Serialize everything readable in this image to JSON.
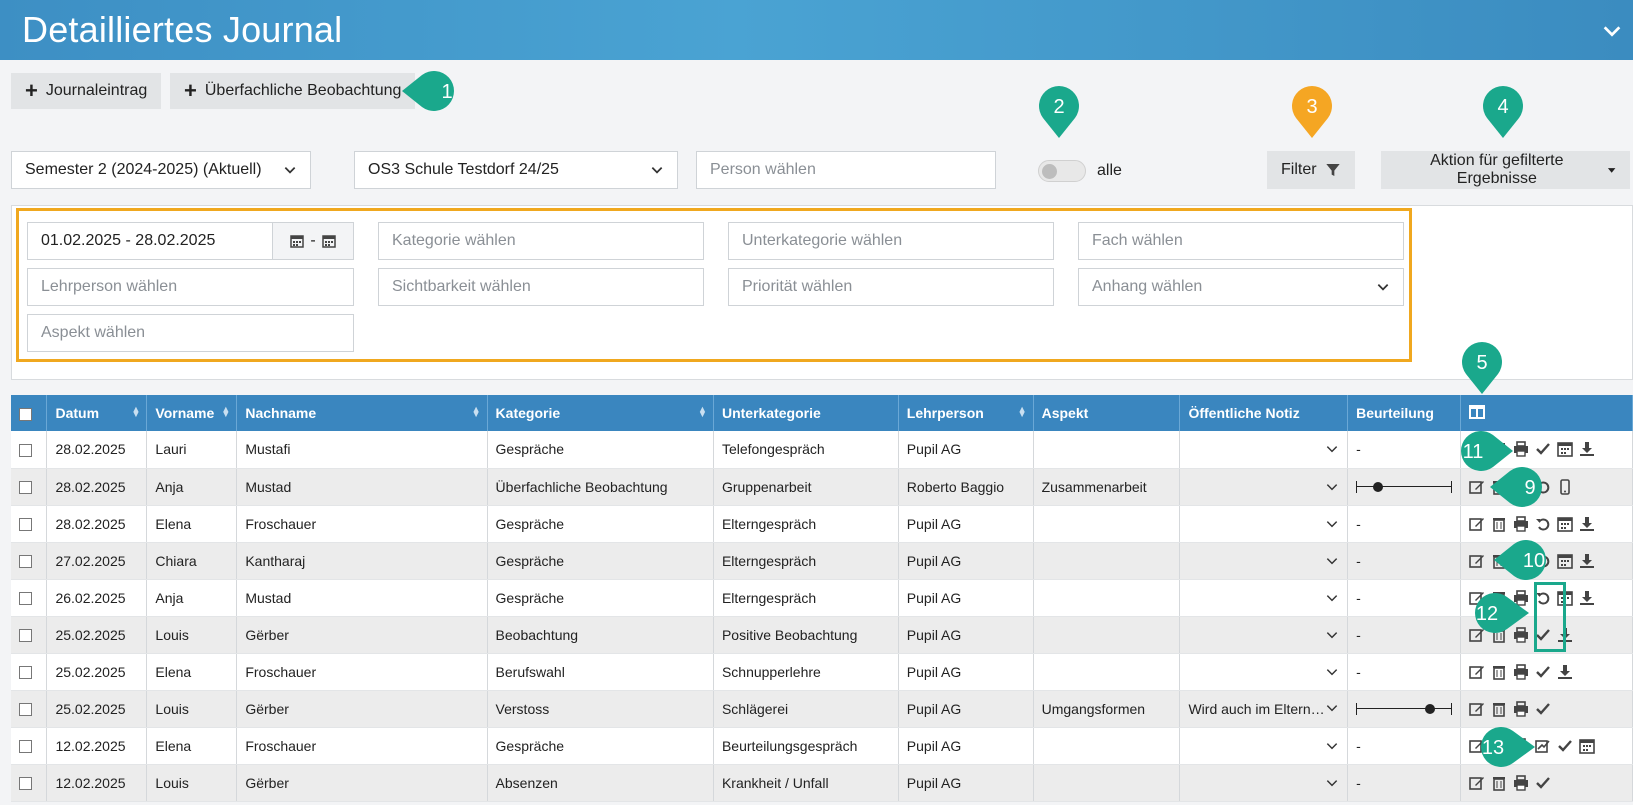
{
  "header": {
    "title": "Detailliertes Journal"
  },
  "toolbar": {
    "journal_entry": "Journaleintrag",
    "cross_subject": "Überfachliche Beobachtung"
  },
  "filters": {
    "semester": "Semester 2 (2024-2025) (Aktuell)",
    "school": "OS3 Schule Testdorf 24/25",
    "person_placeholder": "Person wählen",
    "toggle_label": "alle",
    "filter_button": "Filter",
    "action_button": "Aktion für gefilterte Ergebnisse",
    "date_range": "01.02.2025 - 28.02.2025",
    "date_sep": "-",
    "category_placeholder": "Kategorie wählen",
    "subcategory_placeholder": "Unterkategorie wählen",
    "subject_placeholder": "Fach wählen",
    "teacher_placeholder": "Lehrperson wählen",
    "visibility_placeholder": "Sichtbarkeit wählen",
    "priority_placeholder": "Priorität wählen",
    "attachment_placeholder": "Anhang wählen",
    "aspect_placeholder": "Aspekt wählen"
  },
  "markers": [
    "1",
    "2",
    "3",
    "4",
    "5",
    "9",
    "10",
    "11",
    "12",
    "13"
  ],
  "colors": {
    "header": "#4aa3d3",
    "teal": "#1aa88c",
    "orange": "#f5a623",
    "table_header": "#3a86bf"
  },
  "table": {
    "headers": [
      "Datum",
      "Vorname",
      "Nachname",
      "Kategorie",
      "Unterkategorie",
      "Lehrperson",
      "Aspekt",
      "Öffentliche Notiz",
      "Beurteilung"
    ],
    "rows": [
      {
        "date": "28.02.2025",
        "first": "Lauri",
        "last": "Mustafi",
        "cat": "Gespräche",
        "sub": "Telefongespräch",
        "teacher": "Pupil AG",
        "aspect": "",
        "note": "",
        "rating": "-"
      },
      {
        "date": "28.02.2025",
        "first": "Anja",
        "last": "Mustad",
        "cat": "Überfachliche Beobachtung",
        "sub": "Gruppenarbeit",
        "teacher": "Roberto Baggio",
        "aspect": "Zusammenarbeit",
        "note": "",
        "rating": ""
      },
      {
        "date": "28.02.2025",
        "first": "Elena",
        "last": "Froschauer",
        "cat": "Gespräche",
        "sub": "Elterngespräch",
        "teacher": "Pupil AG",
        "aspect": "",
        "note": "",
        "rating": "-"
      },
      {
        "date": "27.02.2025",
        "first": "Chiara",
        "last": "Kantharaj",
        "cat": "Gespräche",
        "sub": "Elterngespräch",
        "teacher": "Pupil AG",
        "aspect": "",
        "note": "",
        "rating": "-"
      },
      {
        "date": "26.02.2025",
        "first": "Anja",
        "last": "Mustad",
        "cat": "Gespräche",
        "sub": "Elterngespräch",
        "teacher": "Pupil AG",
        "aspect": "",
        "note": "",
        "rating": "-"
      },
      {
        "date": "25.02.2025",
        "first": "Louis",
        "last": "Gërber",
        "cat": "Beobachtung",
        "sub": "Positive Beobachtung",
        "teacher": "Pupil AG",
        "aspect": "",
        "note": "",
        "rating": "-"
      },
      {
        "date": "25.02.2025",
        "first": "Elena",
        "last": "Froschauer",
        "cat": "Berufswahl",
        "sub": "Schnupperlehre",
        "teacher": "Pupil AG",
        "aspect": "",
        "note": "",
        "rating": "-"
      },
      {
        "date": "25.02.2025",
        "first": "Louis",
        "last": "Gërber",
        "cat": "Verstoss",
        "sub": "Schlägerei",
        "teacher": "Pupil AG",
        "aspect": "Umgangsformen",
        "note": "Wird auch im Eltern…",
        "rating": ""
      },
      {
        "date": "12.02.2025",
        "first": "Elena",
        "last": "Froschauer",
        "cat": "Gespräche",
        "sub": "Beurteilungsgespräch",
        "teacher": "Pupil AG",
        "aspect": "",
        "note": "",
        "rating": "-"
      },
      {
        "date": "12.02.2025",
        "first": "Louis",
        "last": "Gërber",
        "cat": "Absenzen",
        "sub": "Krankheit / Unfall",
        "teacher": "Pupil AG",
        "aspect": "",
        "note": "",
        "rating": "-"
      }
    ]
  }
}
